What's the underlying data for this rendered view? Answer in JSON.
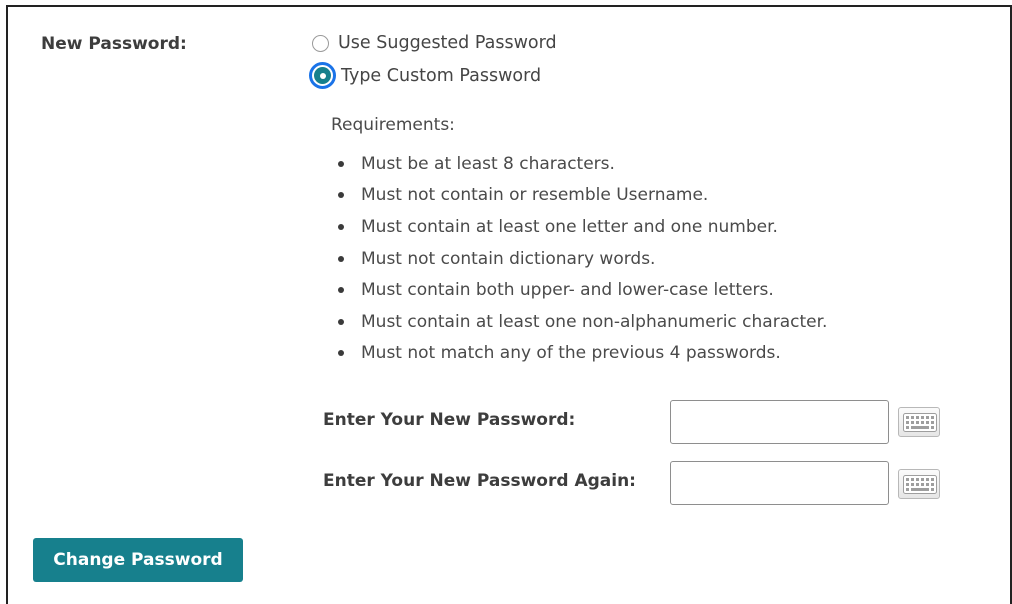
{
  "form": {
    "new_password_label": "New Password:",
    "options": [
      {
        "label": "Use Suggested Password",
        "selected": false
      },
      {
        "label": "Type Custom Password",
        "selected": true
      }
    ],
    "requirements_title": "Requirements:",
    "requirements": [
      "Must be at least 8 characters.",
      "Must not contain or resemble Username.",
      "Must contain at least one letter and one number.",
      "Must not contain dictionary words.",
      "Must contain both upper- and lower-case letters.",
      "Must contain at least one non-alphanumeric character.",
      "Must not match any of the previous 4 passwords."
    ],
    "fields": [
      {
        "label": "Enter Your New Password:",
        "value": "",
        "placeholder": ""
      },
      {
        "label": "Enter Your New Password Again:",
        "value": "",
        "placeholder": ""
      }
    ],
    "submit_label": "Change Password"
  },
  "icons": {
    "keyboard": "keyboard-icon",
    "radio_selected": "radio-selected-icon",
    "radio_unselected": "radio-unselected-icon",
    "bullet": "bullet-icon"
  },
  "colors": {
    "accent": "#17808d",
    "focus_ring": "#1a73e8"
  }
}
